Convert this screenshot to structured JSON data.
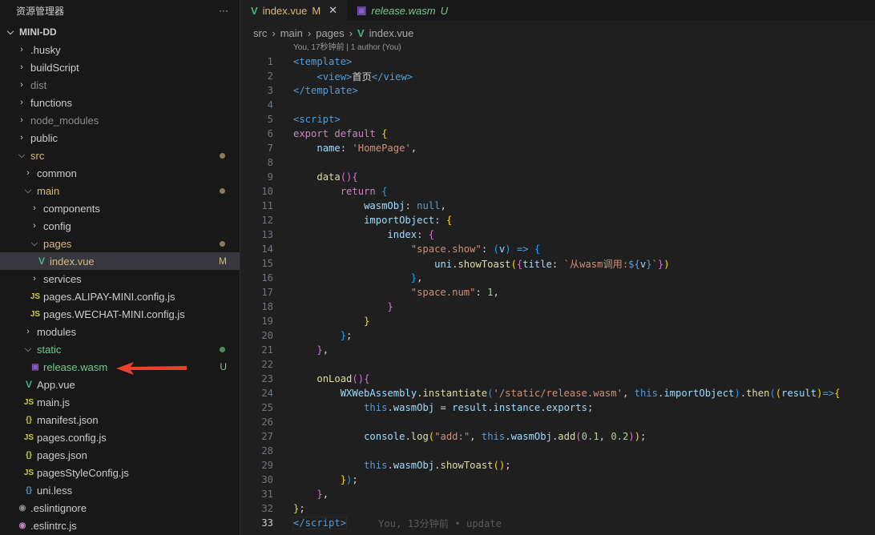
{
  "sidebar": {
    "title": "资源管理器",
    "more": "···",
    "root": "MINI-DD",
    "items": [
      {
        "label": ".husky",
        "indent": 0,
        "kind": "folder",
        "color": "#cccccc"
      },
      {
        "label": "buildScript",
        "indent": 0,
        "kind": "folder",
        "color": "#cccccc"
      },
      {
        "label": "dist",
        "indent": 0,
        "kind": "folder",
        "color": "#8c8c8c"
      },
      {
        "label": "functions",
        "indent": 0,
        "kind": "folder",
        "color": "#cccccc"
      },
      {
        "label": "node_modules",
        "indent": 0,
        "kind": "folder",
        "color": "#8c8c8c"
      },
      {
        "label": "public",
        "indent": 0,
        "kind": "folder",
        "color": "#cccccc"
      },
      {
        "label": "src",
        "indent": 0,
        "kind": "open",
        "color": "#d7ba7d",
        "dot": "#8a7a5a"
      },
      {
        "label": "common",
        "indent": 1,
        "kind": "folder",
        "color": "#cccccc"
      },
      {
        "label": "main",
        "indent": 1,
        "kind": "open",
        "color": "#d7ba7d",
        "dot": "#8a7a5a"
      },
      {
        "label": "components",
        "indent": 2,
        "kind": "folder",
        "color": "#cccccc"
      },
      {
        "label": "config",
        "indent": 2,
        "kind": "folder",
        "color": "#cccccc"
      },
      {
        "label": "pages",
        "indent": 2,
        "kind": "open",
        "color": "#d7ba7d",
        "dot": "#8a7a5a"
      },
      {
        "label": "index.vue",
        "indent": 3,
        "kind": "vue",
        "color": "#d7ba7d",
        "badge": "M",
        "selected": true
      },
      {
        "label": "services",
        "indent": 2,
        "kind": "folder",
        "color": "#cccccc"
      },
      {
        "label": "pages.ALIPAY-MINI.config.js",
        "indent": 2,
        "kind": "js",
        "color": "#cccccc"
      },
      {
        "label": "pages.WECHAT-MINI.config.js",
        "indent": 2,
        "kind": "js",
        "color": "#cccccc"
      },
      {
        "label": "modules",
        "indent": 1,
        "kind": "folder",
        "color": "#cccccc"
      },
      {
        "label": "static",
        "indent": 1,
        "kind": "open",
        "color": "#73c991",
        "dot": "#4b8a60"
      },
      {
        "label": "release.wasm",
        "indent": 2,
        "kind": "wasm",
        "color": "#73c991",
        "badge": "U"
      },
      {
        "label": "App.vue",
        "indent": 1,
        "kind": "vue",
        "color": "#cccccc"
      },
      {
        "label": "main.js",
        "indent": 1,
        "kind": "js",
        "color": "#cccccc"
      },
      {
        "label": "manifest.json",
        "indent": 1,
        "kind": "json",
        "color": "#cccccc"
      },
      {
        "label": "pages.config.js",
        "indent": 1,
        "kind": "js",
        "color": "#cccccc"
      },
      {
        "label": "pages.json",
        "indent": 1,
        "kind": "json",
        "color": "#cccccc"
      },
      {
        "label": "pagesStyleConfig.js",
        "indent": 1,
        "kind": "js",
        "color": "#cccccc"
      },
      {
        "label": "uni.less",
        "indent": 1,
        "kind": "less",
        "color": "#cccccc"
      },
      {
        "label": ".eslintignore",
        "indent": 0,
        "kind": "eslint",
        "color": "#cccccc"
      },
      {
        "label": ".eslintrc.js",
        "indent": 0,
        "kind": "eslintrc",
        "color": "#cccccc"
      }
    ]
  },
  "tabs": [
    {
      "label": "index.vue",
      "badge": "M",
      "icon": "vue-icon",
      "active": true,
      "color": "#d7ba7d"
    },
    {
      "label": "release.wasm",
      "badge": "U",
      "icon": "wasm-icon",
      "active": false,
      "color": "#73c991"
    }
  ],
  "breadcrumb": [
    "src",
    "main",
    "pages",
    "index.vue"
  ],
  "codelens": "You, 17秒钟前 | 1 author (You)",
  "blame": "You, 13分钟前 • update",
  "code": [
    [
      [
        "<template>",
        "tag"
      ]
    ],
    [
      [
        "    "
      ],
      [
        "<view>",
        "tag"
      ],
      [
        "首页",
        "p"
      ],
      [
        "</view>",
        "tag"
      ]
    ],
    [
      [
        "</template>",
        "tag"
      ]
    ],
    [],
    [
      [
        "<script>",
        "tag"
      ]
    ],
    [
      [
        "export default ",
        "kw"
      ],
      [
        "{",
        "b1"
      ]
    ],
    [
      [
        "    "
      ],
      [
        "name",
        "prop"
      ],
      [
        ": ",
        "p"
      ],
      [
        "'HomePage'",
        "str"
      ],
      [
        ",",
        "p"
      ]
    ],
    [],
    [
      [
        "    "
      ],
      [
        "data",
        "fn"
      ],
      [
        "()",
        "b2"
      ],
      [
        "{",
        "b2"
      ]
    ],
    [
      [
        "        "
      ],
      [
        "return ",
        "kw"
      ],
      [
        "{",
        "b3"
      ]
    ],
    [
      [
        "            "
      ],
      [
        "wasmObj",
        "prop"
      ],
      [
        ": ",
        "p"
      ],
      [
        "null",
        "tag"
      ],
      [
        ",",
        "p"
      ]
    ],
    [
      [
        "            "
      ],
      [
        "importObject",
        "prop"
      ],
      [
        ": ",
        "p"
      ],
      [
        "{",
        "b1"
      ]
    ],
    [
      [
        "                "
      ],
      [
        "index",
        "prop"
      ],
      [
        ": ",
        "p"
      ],
      [
        "{",
        "b2"
      ]
    ],
    [
      [
        "                    "
      ],
      [
        "\"space.show\"",
        "str"
      ],
      [
        ": ",
        "p"
      ],
      [
        "(",
        "b3"
      ],
      [
        "v",
        "prop"
      ],
      [
        ")",
        "b3"
      ],
      [
        " => ",
        "tag"
      ],
      [
        "{",
        "b3"
      ]
    ],
    [
      [
        "                        "
      ],
      [
        "uni",
        "prop"
      ],
      [
        ".",
        "p"
      ],
      [
        "showToast",
        "fn"
      ],
      [
        "(",
        "b1"
      ],
      [
        "{",
        "b2"
      ],
      [
        "title",
        "prop"
      ],
      [
        ": ",
        "p"
      ],
      [
        "`从wasm调用:",
        "str"
      ],
      [
        "${",
        "tag"
      ],
      [
        "v",
        "prop"
      ],
      [
        "}",
        "tag"
      ],
      [
        "`",
        "str"
      ],
      [
        "}",
        "b2"
      ],
      [
        ")",
        "b1"
      ]
    ],
    [
      [
        "                    "
      ],
      [
        "}",
        "b3"
      ],
      [
        ",",
        "p"
      ]
    ],
    [
      [
        "                    "
      ],
      [
        "\"space.num\"",
        "str"
      ],
      [
        ": ",
        "p"
      ],
      [
        "1",
        "num"
      ],
      [
        ",",
        "p"
      ]
    ],
    [
      [
        "                "
      ],
      [
        "}",
        "b2"
      ]
    ],
    [
      [
        "            "
      ],
      [
        "}",
        "b1"
      ]
    ],
    [
      [
        "        "
      ],
      [
        "}",
        "b3"
      ],
      [
        ";",
        "p"
      ]
    ],
    [
      [
        "    "
      ],
      [
        "}",
        "b2"
      ],
      [
        ",",
        "p"
      ]
    ],
    [],
    [
      [
        "    "
      ],
      [
        "onLoad",
        "fn"
      ],
      [
        "()",
        "b2"
      ],
      [
        "{",
        "b2"
      ]
    ],
    [
      [
        "        "
      ],
      [
        "WXWebAssembly",
        "prop"
      ],
      [
        ".",
        "p"
      ],
      [
        "instantiate",
        "fn"
      ],
      [
        "(",
        "b3"
      ],
      [
        "'/static/release.wasm'",
        "str"
      ],
      [
        ", ",
        "p"
      ],
      [
        "this",
        "this"
      ],
      [
        ".",
        "p"
      ],
      [
        "importObject",
        "prop"
      ],
      [
        ")",
        "b3"
      ],
      [
        ".",
        "p"
      ],
      [
        "then",
        "fn"
      ],
      [
        "(",
        "b3"
      ],
      [
        "(",
        "b1"
      ],
      [
        "result",
        "prop"
      ],
      [
        ")",
        "b1"
      ],
      [
        "=>",
        "tag"
      ],
      [
        "{",
        "b1"
      ]
    ],
    [
      [
        "            "
      ],
      [
        "this",
        "this"
      ],
      [
        ".",
        "p"
      ],
      [
        "wasmObj",
        "prop"
      ],
      [
        " = ",
        "p"
      ],
      [
        "result",
        "prop"
      ],
      [
        ".",
        "p"
      ],
      [
        "instance",
        "prop"
      ],
      [
        ".",
        "p"
      ],
      [
        "exports",
        "prop"
      ],
      [
        ";",
        "p"
      ]
    ],
    [],
    [
      [
        "            "
      ],
      [
        "console",
        "prop"
      ],
      [
        ".",
        "p"
      ],
      [
        "log",
        "fn"
      ],
      [
        "(",
        "b1"
      ],
      [
        "\"add:\"",
        "str"
      ],
      [
        ", ",
        "p"
      ],
      [
        "this",
        "this"
      ],
      [
        ".",
        "p"
      ],
      [
        "wasmObj",
        "prop"
      ],
      [
        ".",
        "p"
      ],
      [
        "add",
        "fn"
      ],
      [
        "(",
        "b2"
      ],
      [
        "0.1",
        "num"
      ],
      [
        ", ",
        "p"
      ],
      [
        "0.2",
        "num"
      ],
      [
        ")",
        "b2"
      ],
      [
        ")",
        "b1"
      ],
      [
        ";",
        "p"
      ]
    ],
    [],
    [
      [
        "            "
      ],
      [
        "this",
        "this"
      ],
      [
        ".",
        "p"
      ],
      [
        "wasmObj",
        "prop"
      ],
      [
        ".",
        "p"
      ],
      [
        "showToast",
        "fn"
      ],
      [
        "()",
        "b1"
      ],
      [
        ";",
        "p"
      ]
    ],
    [
      [
        "        "
      ],
      [
        "}",
        "b1"
      ],
      [
        ")",
        "b3"
      ],
      [
        ";",
        "p"
      ]
    ],
    [
      [
        "    "
      ],
      [
        "}",
        "b2"
      ],
      [
        ",",
        "p"
      ]
    ],
    [
      [
        "}",
        "b1"
      ],
      [
        ";",
        "p"
      ]
    ],
    [
      [
        "</script>",
        "tag"
      ]
    ]
  ],
  "current_line": 33
}
